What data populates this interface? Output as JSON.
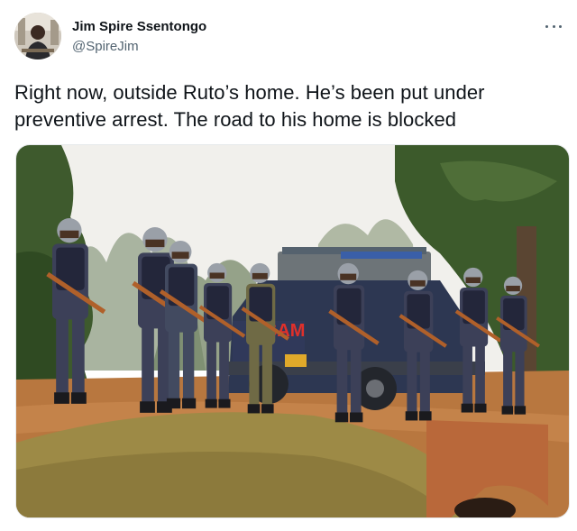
{
  "author": {
    "display_name": "Jim Spire Ssentongo",
    "handle": "@SpireJim",
    "avatar_icon": "profile-avatar"
  },
  "tweet": {
    "text": "Right now, outside Ruto’s home. He’s been put under preventive arrest. The road to his home is blocked",
    "more_icon": "more-options-icon"
  },
  "media": {
    "description_icon": "photo",
    "vehicle_lettering": "SAM"
  },
  "colors": {
    "text_primary": "#0f1419",
    "text_secondary": "#536471",
    "uniform_camo": "#3c4058",
    "vehicle_blue": "#2c3550",
    "ground": "#b3703c",
    "grass": "#9a8a45",
    "sky": "#f3f2ee",
    "foliage": "#3d5a2c"
  }
}
